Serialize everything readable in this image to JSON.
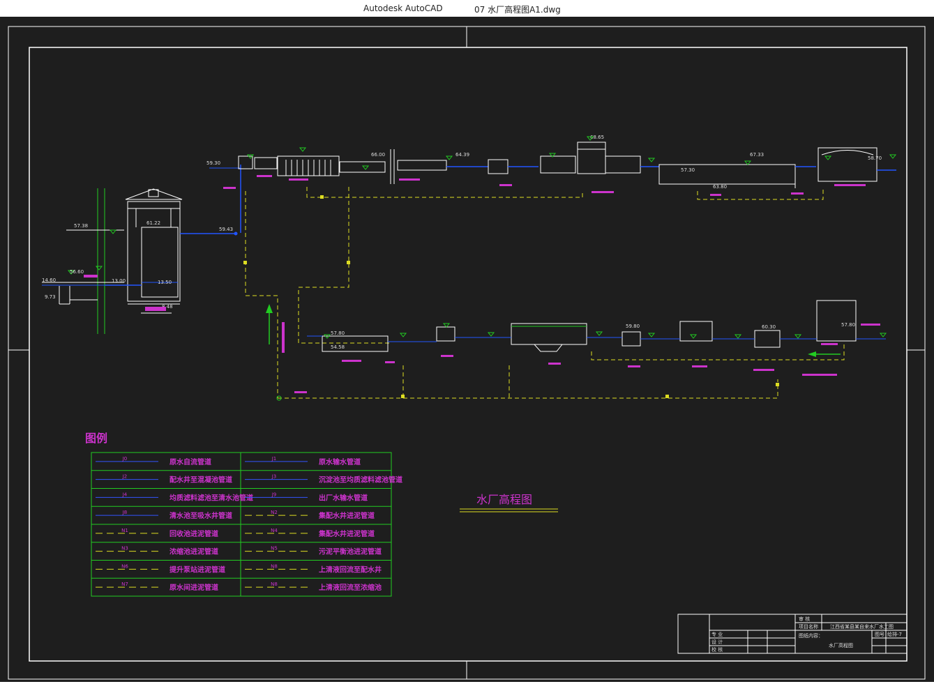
{
  "window": {
    "app_name": "Autodesk AutoCAD",
    "file_name": "07 水厂高程图A1.dwg"
  },
  "drawing": {
    "title": "水厂高程图",
    "legend_heading": "图例",
    "legend": [
      {
        "code": "J0",
        "label": "原水自流管道",
        "style": "solid"
      },
      {
        "code": "J1",
        "label": "原水输水管道",
        "style": "solid"
      },
      {
        "code": "J2",
        "label": "配水井至混凝池管道",
        "style": "solid"
      },
      {
        "code": "J3",
        "label": "沉淀池至均质滤料滤池管道",
        "style": "solid"
      },
      {
        "code": "J4",
        "label": "均质滤料滤池至清水池管道",
        "style": "solid"
      },
      {
        "code": "J9",
        "label": "出厂水输水管道",
        "style": "solid"
      },
      {
        "code": "J8",
        "label": "清水池至吸水井管道",
        "style": "solid"
      },
      {
        "code": "N2",
        "label": "集配水井进泥管道",
        "style": "dashed"
      },
      {
        "code": "N1",
        "label": "回收池进泥管道",
        "style": "dashed"
      },
      {
        "code": "N4",
        "label": "集配水井进泥管道",
        "style": "dashed"
      },
      {
        "code": "N3",
        "label": "浓缩池进泥管道",
        "style": "dashed"
      },
      {
        "code": "N5",
        "label": "污泥平衡池进泥管道",
        "style": "dashed"
      },
      {
        "code": "N6",
        "label": "提升泵站进泥管道",
        "style": "dashed"
      },
      {
        "code": "N8",
        "label": "上清液回流至配水井",
        "style": "dashed"
      },
      {
        "code": "N7",
        "label": "原水间进泥管道",
        "style": "dashed"
      },
      {
        "code": "N8",
        "label": "上清液回流至浓缩池",
        "style": "dashed"
      }
    ],
    "elevations": {
      "river_high": "57.38",
      "river_mid": "56.60",
      "river_low": "14.60",
      "river_min": "9.73",
      "intake_top": "61.22",
      "intake_mid": "13.00",
      "intake_base": "13.50",
      "intake_bottom": "8.48",
      "pipe_entry": "59.43",
      "plant_a": "59.30",
      "plant_b": "68.65",
      "plant_c": "66.00",
      "plant_d": "64.39",
      "plant_e": "67.33",
      "plant_f": "63.80",
      "clearwell": "57.30",
      "pumphouse": "58.70",
      "sludge_a": "57.80",
      "sludge_b": "54.58",
      "sludge_c": "59.80",
      "sludge_d": "60.30",
      "sludge_e": "57.80"
    },
    "title_block": {
      "project": "江西省某县某自来水厂水工图",
      "content_label": "图纸内容：",
      "content": "水厂高程图",
      "drawing_no_label": "图号",
      "drawing_no": "给排-7",
      "roles": [
        "专 业",
        "设 计",
        "校 核"
      ],
      "stamps": [
        "审 核",
        "项目名称"
      ]
    }
  }
}
